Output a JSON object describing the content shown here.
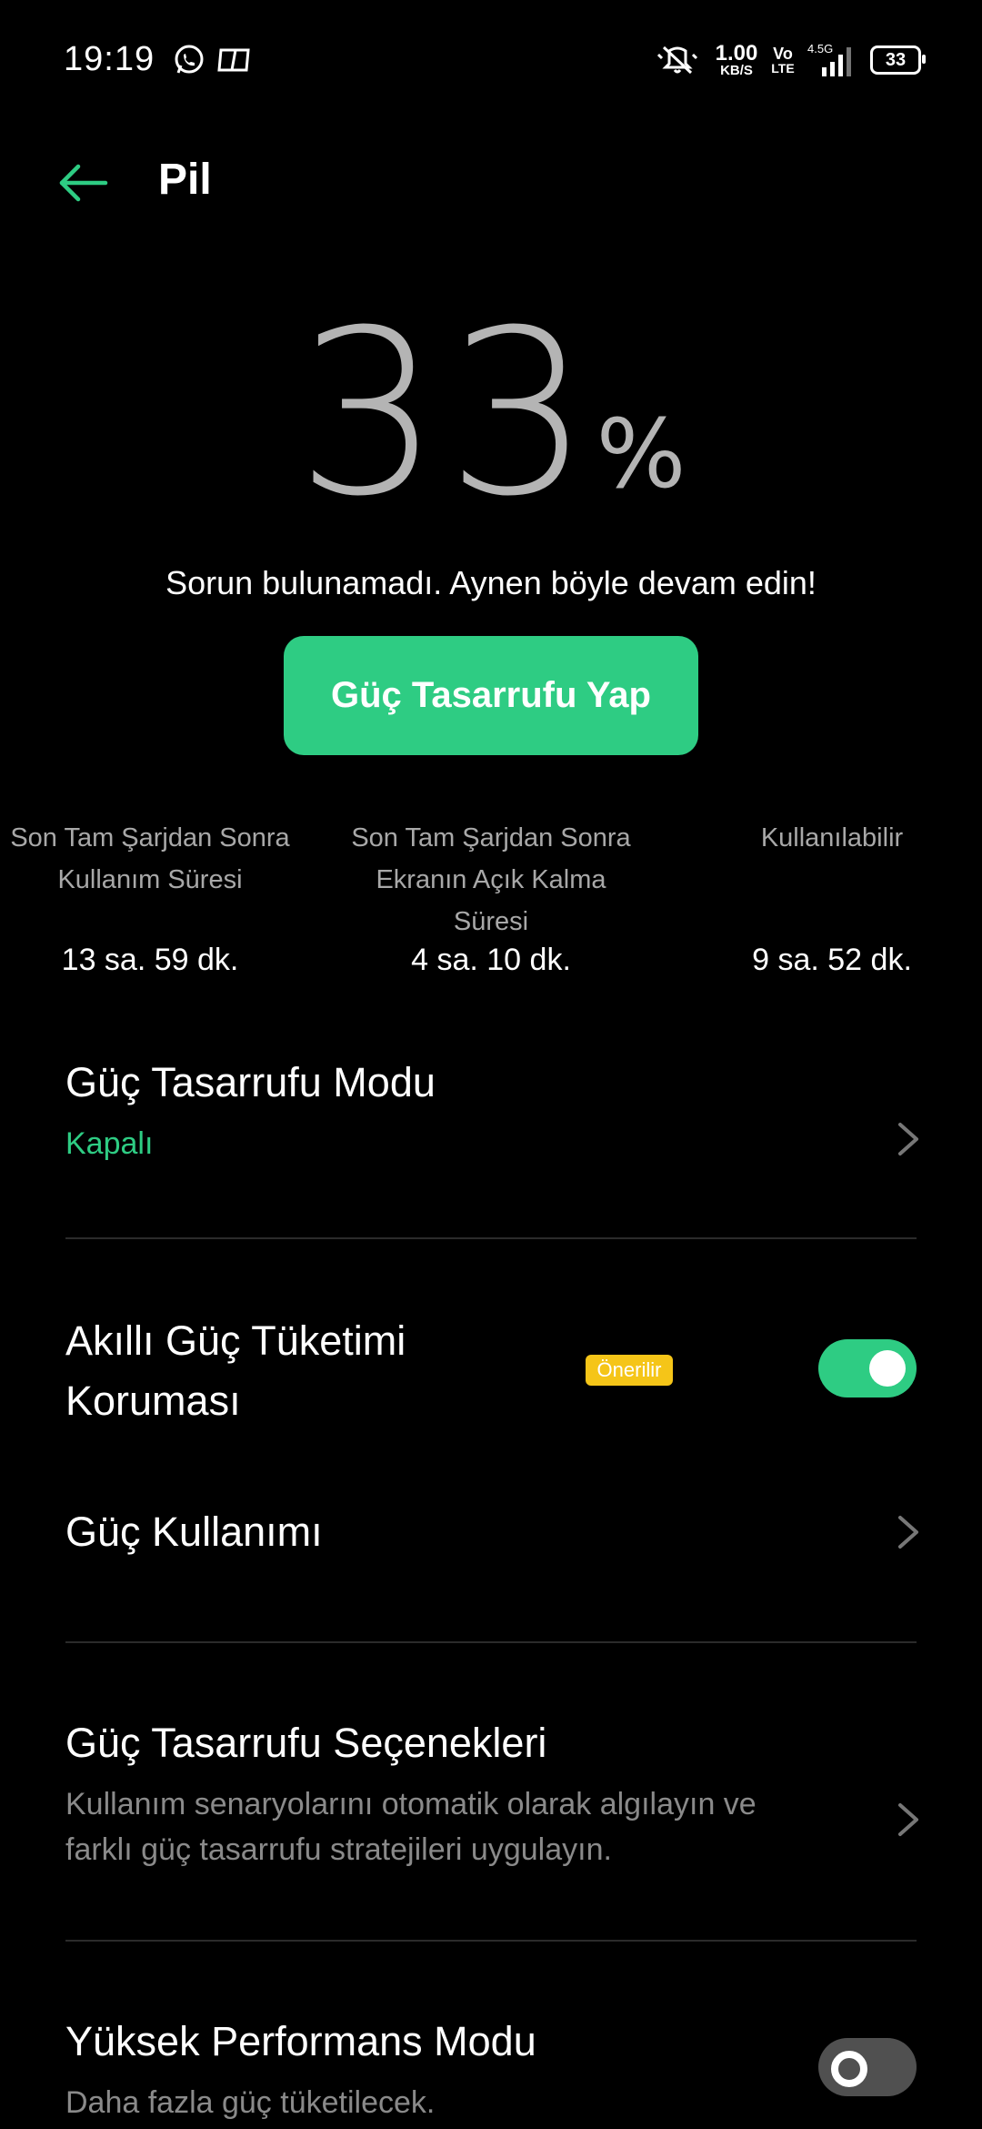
{
  "status_bar": {
    "time": "19:19",
    "network_speed_value": "1.00",
    "network_speed_unit": "KB/S",
    "volte_top": "Vo",
    "volte_bottom": "LTE",
    "signal_label": "4.5G",
    "battery_level": "33",
    "icons": [
      "whatsapp-icon",
      "app-notification-icon",
      "mute-icon",
      "signal-icon",
      "battery-icon"
    ]
  },
  "header": {
    "title": "Pil"
  },
  "battery": {
    "percent": "33",
    "unit": "%",
    "message": "Sorun bulunamadı. Aynen böyle devam edin!",
    "button_label": "Güç Tasarrufu Yap"
  },
  "stats": [
    {
      "label": "Son Tam Şarjdan Sonra Kullanım Süresi",
      "value": "13 sa. 59 dk."
    },
    {
      "label": "Son Tam Şarjdan Sonra Ekranın Açık Kalma Süresi",
      "value": "4 sa. 10 dk."
    },
    {
      "label": "Kullanılabilir",
      "value": "9 sa. 52 dk."
    }
  ],
  "settings": {
    "power_saving_mode": {
      "title": "Güç Tasarrufu Modu",
      "status": "Kapalı"
    },
    "smart_protection": {
      "title_line1": "Akıllı Güç Tüketimi",
      "title_line2": "Koruması",
      "badge": "Önerilir",
      "enabled": true
    },
    "power_usage": {
      "title": "Güç Kullanımı"
    },
    "power_saving_options": {
      "title": "Güç Tasarrufu Seçenekleri",
      "description_line1": "Kullanım senaryolarını otomatik olarak algılayın ve",
      "description_line2": "farklı güç tasarrufu stratejileri uygulayın."
    },
    "high_performance": {
      "title": "Yüksek Performans Modu",
      "description": "Daha fazla güç tüketilecek.",
      "enabled": false
    }
  },
  "colors": {
    "accent": "#2ecc83",
    "badge": "#f5c518",
    "background": "#000000",
    "percent_text": "#b4b4b4"
  }
}
